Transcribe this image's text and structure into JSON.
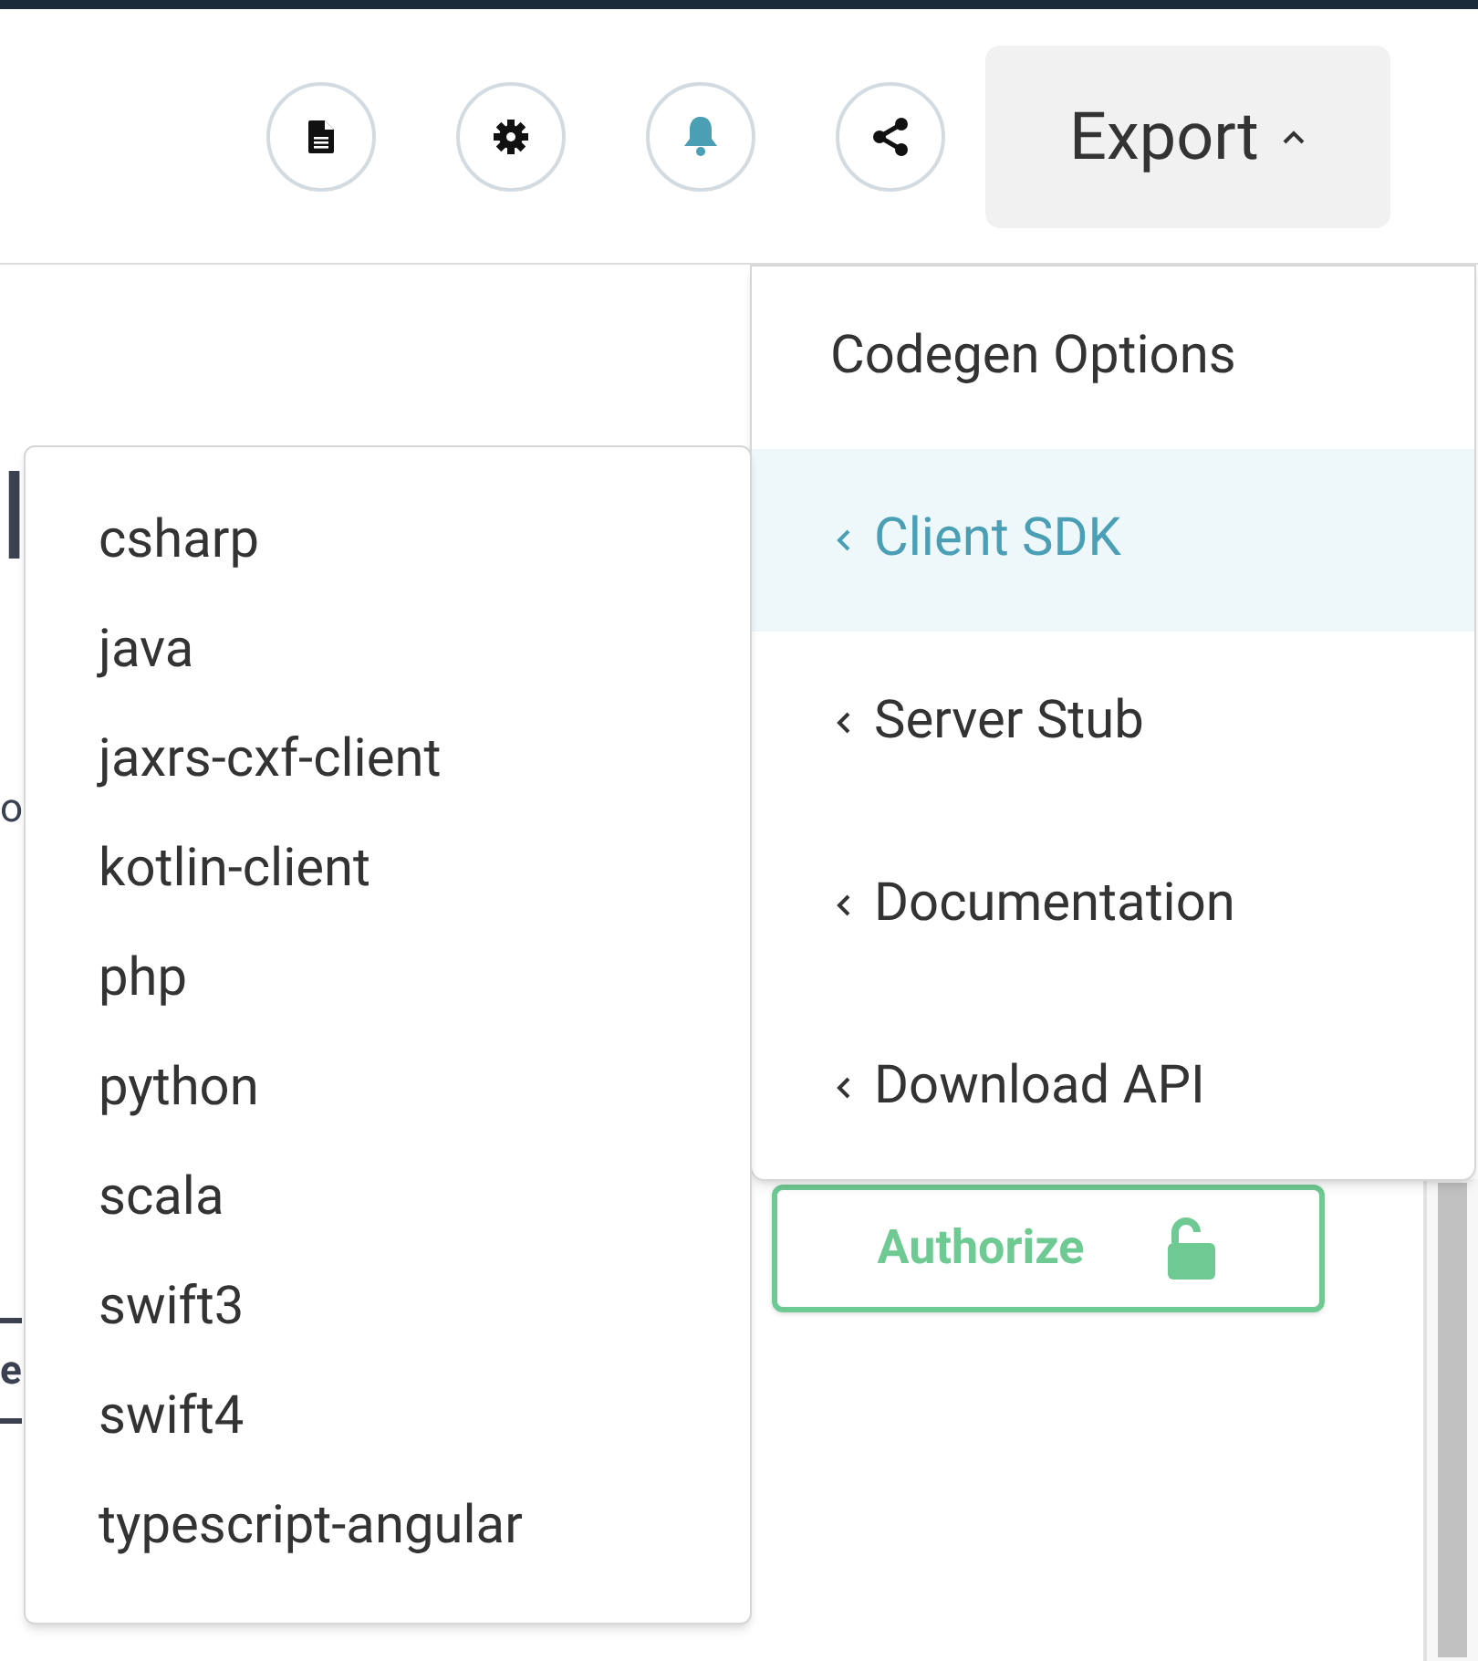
{
  "toolbar": {
    "icons": [
      {
        "kind": "document",
        "active": false
      },
      {
        "kind": "gear",
        "active": false
      },
      {
        "kind": "bell",
        "active": true
      },
      {
        "kind": "share",
        "active": false
      }
    ],
    "export_button": {
      "label": "Export",
      "expanded": true
    }
  },
  "background": {
    "heading": "l",
    "text": "o",
    "button": "e"
  },
  "export_menu": {
    "header": "Codegen Options",
    "items": [
      {
        "label": "Client SDK",
        "selected": true
      },
      {
        "label": "Server Stub",
        "selected": false
      },
      {
        "label": "Documentation",
        "selected": false
      },
      {
        "label": "Download API",
        "selected": false
      }
    ]
  },
  "submenu": {
    "items": [
      "csharp",
      "java",
      "jaxrs-cxf-client",
      "kotlin-client",
      "php",
      "python",
      "scala",
      "swift3",
      "swift4",
      "typescript-angular"
    ]
  },
  "authorize_button": {
    "label": "Authorize"
  }
}
